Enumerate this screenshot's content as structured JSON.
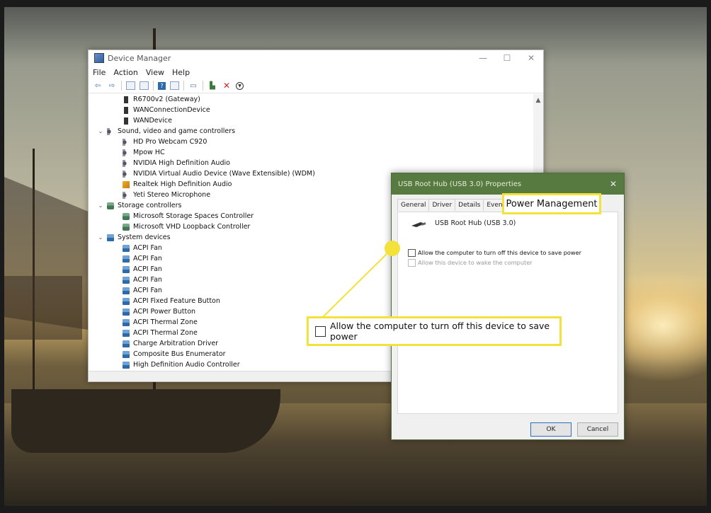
{
  "device_manager": {
    "title": "Device Manager",
    "window_controls": {
      "minimize": "—",
      "maximize": "☐",
      "close": "✕"
    },
    "menu": [
      "File",
      "Action",
      "View",
      "Help"
    ],
    "tree": [
      {
        "label": "R6700v2 (Gateway)",
        "icon": "device-icon",
        "level": 2
      },
      {
        "label": "WANConnectionDevice",
        "icon": "device-icon",
        "level": 2
      },
      {
        "label": "WANDevice",
        "icon": "device-icon",
        "level": 2
      },
      {
        "label": "Sound, video and game controllers",
        "icon": "speaker-icon",
        "level": 1,
        "expanded": true
      },
      {
        "label": "HD Pro Webcam C920",
        "icon": "speaker-icon",
        "level": 2
      },
      {
        "label": "Mpow HC",
        "icon": "speaker-icon",
        "level": 2
      },
      {
        "label": "NVIDIA High Definition Audio",
        "icon": "speaker-icon",
        "level": 2
      },
      {
        "label": "NVIDIA Virtual Audio Device (Wave Extensible) (WDM)",
        "icon": "speaker-icon",
        "level": 2
      },
      {
        "label": "Realtek High Definition Audio",
        "icon": "warning-speaker-icon",
        "level": 2
      },
      {
        "label": "Yeti Stereo Microphone",
        "icon": "speaker-icon",
        "level": 2
      },
      {
        "label": "Storage controllers",
        "icon": "storage-icon",
        "level": 1,
        "expanded": true
      },
      {
        "label": "Microsoft Storage Spaces Controller",
        "icon": "storage-icon",
        "level": 2
      },
      {
        "label": "Microsoft VHD Loopback Controller",
        "icon": "storage-icon",
        "level": 2
      },
      {
        "label": "System devices",
        "icon": "system-icon",
        "level": 1,
        "expanded": true
      },
      {
        "label": "ACPI Fan",
        "icon": "system-icon",
        "level": 2
      },
      {
        "label": "ACPI Fan",
        "icon": "system-icon",
        "level": 2
      },
      {
        "label": "ACPI Fan",
        "icon": "system-icon",
        "level": 2
      },
      {
        "label": "ACPI Fan",
        "icon": "system-icon",
        "level": 2
      },
      {
        "label": "ACPI Fan",
        "icon": "system-icon",
        "level": 2
      },
      {
        "label": "ACPI Fixed Feature Button",
        "icon": "system-icon",
        "level": 2
      },
      {
        "label": "ACPI Power Button",
        "icon": "system-icon",
        "level": 2
      },
      {
        "label": "ACPI Thermal Zone",
        "icon": "system-icon",
        "level": 2
      },
      {
        "label": "ACPI Thermal Zone",
        "icon": "system-icon",
        "level": 2
      },
      {
        "label": "Charge Arbitration Driver",
        "icon": "system-icon",
        "level": 2
      },
      {
        "label": "Composite Bus Enumerator",
        "icon": "system-icon",
        "level": 2
      },
      {
        "label": "High Definition Audio Controller",
        "icon": "system-icon",
        "level": 2
      }
    ]
  },
  "properties_dialog": {
    "title": "USB Root Hub (USB 3.0) Properties",
    "close_glyph": "✕",
    "tabs": [
      "General",
      "Driver",
      "Details",
      "Events"
    ],
    "active_tab": "Power Management",
    "device_name": "USB Root Hub (USB 3.0)",
    "options": [
      {
        "label": "Allow the computer to turn off this device to save power",
        "checked": false,
        "enabled": true
      },
      {
        "label": "Allow this device to wake the computer",
        "checked": false,
        "enabled": false
      }
    ],
    "ok_label": "OK",
    "cancel_label": "Cancel"
  },
  "callouts": {
    "tab_label": "Power Management",
    "option_label": "Allow the computer to turn off this device to save power",
    "color": "#f3e23a"
  }
}
